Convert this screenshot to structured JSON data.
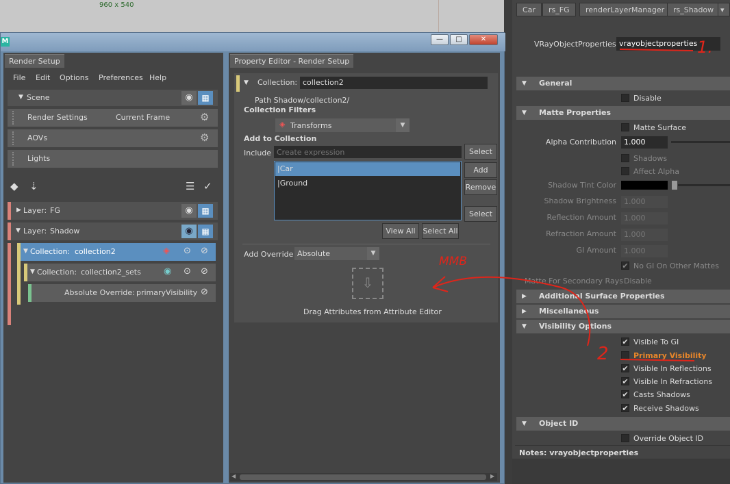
{
  "viewport": {
    "resolution": "960 x 540"
  },
  "window": {
    "min": "—",
    "max": "□",
    "close": "✕",
    "logo": "M"
  },
  "render_setup": {
    "tab": "Render Setup",
    "menus": [
      "File",
      "Edit",
      "Options",
      "Preferences",
      "Help"
    ],
    "scene_label": "Scene",
    "render_settings": "Render Settings",
    "current_frame": "Current Frame",
    "aovs": "AOVs",
    "lights": "Lights",
    "layer_fg": {
      "label": "Layer:",
      "name": "FG"
    },
    "layer_shadow": {
      "label": "Layer:",
      "name": "Shadow"
    },
    "collection2": {
      "label": "Collection:",
      "name": "collection2"
    },
    "collection2_sets": {
      "label": "Collection:",
      "name": "collection2_sets"
    },
    "override": {
      "label": "Absolute Override:",
      "name": "primaryVisibility"
    }
  },
  "property_editor": {
    "tab": "Property Editor - Render Setup",
    "collection_label": "Collection:",
    "collection_value": "collection2",
    "path": "Path  Shadow/collection2/",
    "collection_filters": "Collection Filters",
    "filter_value": "Transforms",
    "add_to_collection": "Add to Collection",
    "include_label": "Include",
    "include_placeholder": "Create expression",
    "select": "Select",
    "add": "Add",
    "remove": "Remove",
    "select2": "Select",
    "items": [
      "|Car",
      "|Ground"
    ],
    "view_all": "View All",
    "select_all": "Select All",
    "add_override_label": "Add Override",
    "override_value": "Absolute",
    "drag_text": "Drag Attributes from Attribute Editor"
  },
  "attribute_editor": {
    "tabs": [
      "Car",
      "rs_FG",
      "renderLayerManager",
      "rs_Shadow"
    ],
    "node_label": "VRayObjectProperties:",
    "node_value": "vrayobjectproperties",
    "sections": {
      "general": "General",
      "matte": "Matte Properties",
      "additional": "Additional Surface Properties",
      "misc": "Miscellaneous",
      "visibility": "Visibility Options",
      "objectid": "Object ID"
    },
    "disable": "Disable",
    "matte_surface": "Matte Surface",
    "alpha_contribution": "Alpha Contribution",
    "alpha_value": "1.000",
    "shadows": "Shadows",
    "affect_alpha": "Affect Alpha",
    "shadow_tint": "Shadow Tint Color",
    "shadow_brightness": "Shadow Brightness",
    "reflection_amount": "Reflection Amount",
    "refraction_amount": "Refraction Amount",
    "gi_amount": "GI Amount",
    "field_value": "1.000",
    "no_gi": "No GI On Other Mattes",
    "matte_secondary": "Matte For Secondary Rays",
    "matte_secondary_value": "Disable",
    "visible_gi": "Visible To GI",
    "primary_visibility": "Primary Visibility",
    "visible_reflections": "Visible In Reflections",
    "visible_refractions": "Visible In Refractions",
    "casts_shadows": "Casts Shadows",
    "receive_shadows": "Receive Shadows",
    "override_object_id": "Override Object ID",
    "notes": "Notes:  vrayobjectproperties"
  },
  "annotations": {
    "mmb": "MMB",
    "one": "1.",
    "two": "2"
  },
  "colors": {
    "accent": "#5b8fbf",
    "annotation": "#e0251a",
    "layer_stripe": "#d9827a",
    "collection_stripe": "#d8c97a",
    "override_stripe": "#7ac28f"
  }
}
